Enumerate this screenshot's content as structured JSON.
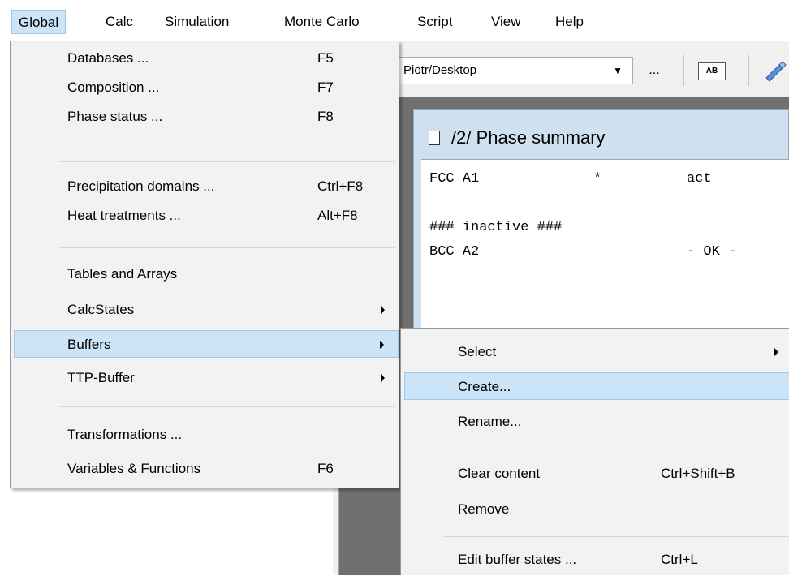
{
  "menubar": {
    "items": [
      {
        "label": "Global",
        "active": true
      },
      {
        "label": "Calc"
      },
      {
        "label": "Simulation"
      },
      {
        "label": "Monte Carlo"
      },
      {
        "label": "Script"
      },
      {
        "label": "View"
      },
      {
        "label": "Help"
      }
    ]
  },
  "toolbar": {
    "path_value": "Piotr/Desktop",
    "browse_label": "...",
    "ab_label": "AB"
  },
  "phase_window": {
    "title": "/2/ Phase summary",
    "lines": [
      {
        "col1": "FCC_A1",
        "col2": "*",
        "col3": "act"
      },
      {
        "col1": "### inactive ###"
      },
      {
        "col1": "BCC_A2",
        "col3": "- OK -"
      }
    ]
  },
  "global_menu": {
    "items": [
      {
        "label": "Databases ...",
        "shortcut": "F5"
      },
      {
        "label": "Composition ...",
        "shortcut": "F7"
      },
      {
        "label": "Phase status ...",
        "shortcut": "F8"
      },
      {
        "label": "Precipitation domains ...",
        "shortcut": "Ctrl+F8"
      },
      {
        "label": "Heat treatments ...",
        "shortcut": "Alt+F8"
      },
      {
        "label": "Tables and Arrays",
        "shortcut": ""
      },
      {
        "label": "CalcStates",
        "shortcut": "",
        "submenu": true
      },
      {
        "label": "Buffers",
        "shortcut": "",
        "submenu": true,
        "highlighted": true
      },
      {
        "label": "TTP-Buffer",
        "shortcut": "",
        "submenu": true
      },
      {
        "label": "Transformations ...",
        "shortcut": ""
      },
      {
        "label": "Variables & Functions",
        "shortcut": "F6"
      }
    ]
  },
  "buffers_menu": {
    "items": [
      {
        "label": "Select",
        "shortcut": "",
        "submenu": true
      },
      {
        "label": "Create...",
        "shortcut": "",
        "highlighted": true
      },
      {
        "label": "Rename...",
        "shortcut": ""
      },
      {
        "label": "Clear content",
        "shortcut": "Ctrl+Shift+B"
      },
      {
        "label": "Remove",
        "shortcut": ""
      },
      {
        "label": "Edit buffer states ...",
        "shortcut": "Ctrl+L"
      }
    ]
  },
  "colors": {
    "highlight_bg": "#cce4f7",
    "highlight_border": "#99c9ef",
    "menu_bg": "#f2f2f2",
    "workspace_bg": "#6f6f6f",
    "window_frame": "#cfe0f1"
  }
}
